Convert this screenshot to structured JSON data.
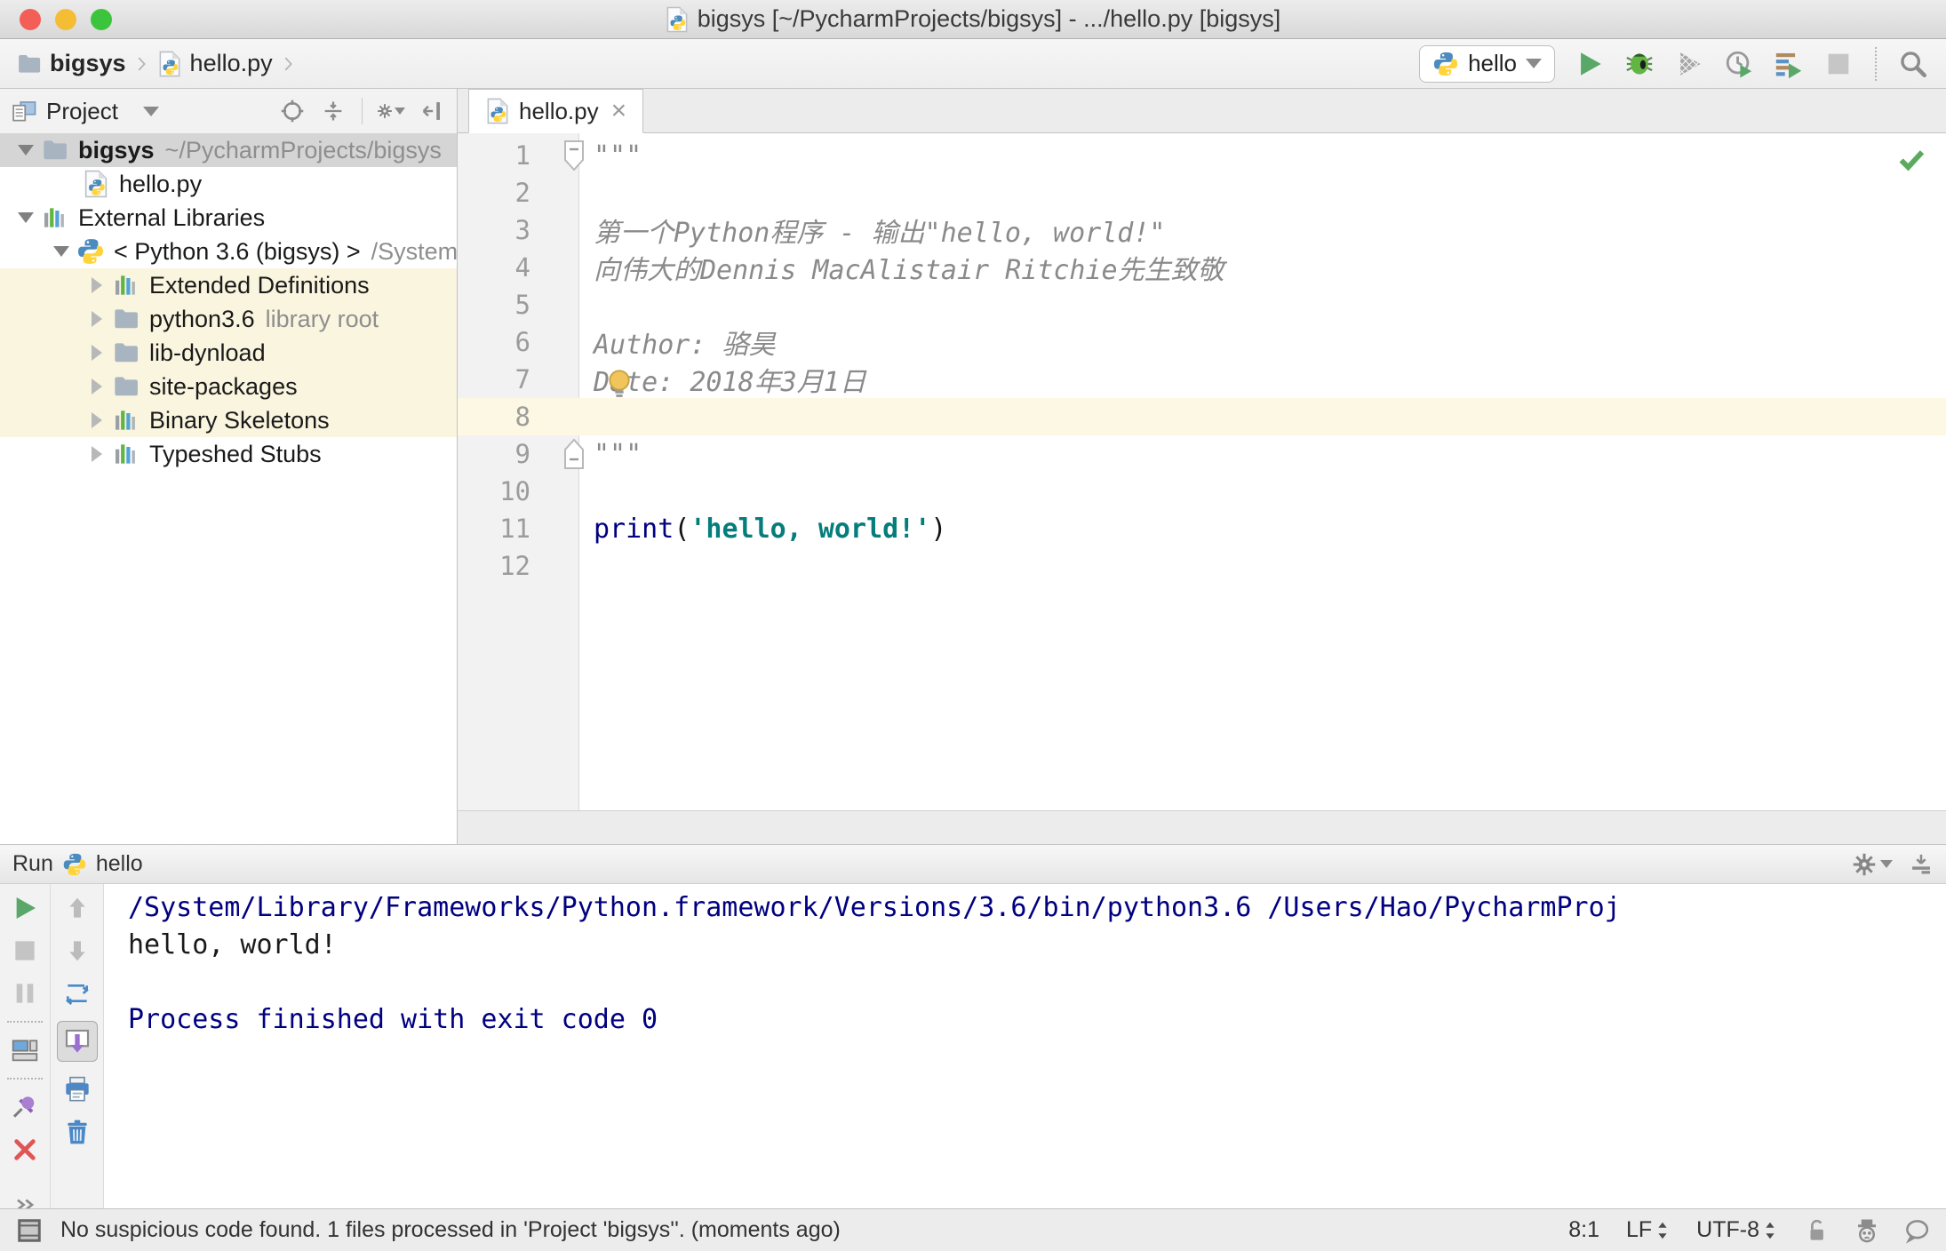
{
  "window": {
    "title": "bigsys [~/PycharmProjects/bigsys] - .../hello.py [bigsys]"
  },
  "navbar": {
    "breadcrumbs": [
      {
        "label": "bigsys",
        "icon": "folder",
        "bold": true
      },
      {
        "label": "hello.py",
        "icon": "pyfile",
        "bold": false
      }
    ],
    "run_config": {
      "label": "hello",
      "icon": "python"
    },
    "actions": [
      {
        "name": "run"
      },
      {
        "name": "debug"
      },
      {
        "name": "run-with-coverage"
      },
      {
        "name": "profiler"
      },
      {
        "name": "concurrency-diagram"
      },
      {
        "name": "stop",
        "disabled": true
      }
    ],
    "search": {
      "name": "search"
    }
  },
  "project_panel": {
    "title": "Project",
    "header_actions": [
      {
        "name": "locate"
      },
      {
        "name": "collapse-all"
      },
      {
        "name": "separator"
      },
      {
        "name": "settings",
        "caret": true
      },
      {
        "name": "hide-panel"
      }
    ],
    "tree": [
      {
        "label": "bigsys",
        "suffix": "~/PycharmProjects/bigsys",
        "icon": "folder",
        "arrow": "down",
        "indent": 0,
        "selected": true,
        "bold": true
      },
      {
        "label": "hello.py",
        "icon": "pyfile",
        "arrow": "none",
        "indent": 2
      },
      {
        "label": "External Libraries",
        "icon": "lib",
        "arrow": "down",
        "indent": 0
      },
      {
        "label": "< Python 3.6 (bigsys) >",
        "suffix": "/System",
        "icon": "python",
        "arrow": "down",
        "indent": 1
      },
      {
        "label": "Extended Definitions",
        "icon": "lib",
        "arrow": "right",
        "indent": 2,
        "highlight": true
      },
      {
        "label": "python3.6",
        "suffix": "library root",
        "icon": "folder",
        "arrow": "right",
        "indent": 2,
        "highlight": true
      },
      {
        "label": "lib-dynload",
        "icon": "folder",
        "arrow": "right",
        "indent": 2,
        "highlight": true
      },
      {
        "label": "site-packages",
        "icon": "folder",
        "arrow": "right",
        "indent": 2,
        "highlight": true
      },
      {
        "label": "Binary Skeletons",
        "icon": "lib",
        "arrow": "right",
        "indent": 2,
        "highlight": true
      },
      {
        "label": "Typeshed Stubs",
        "icon": "lib",
        "arrow": "right",
        "indent": 2
      }
    ]
  },
  "editor": {
    "tab": {
      "label": "hello.py",
      "icon": "pyfile"
    },
    "inspection_status": "ok",
    "lines": [
      {
        "n": 1,
        "tokens": [
          {
            "t": "\"\"\"",
            "c": "comment"
          }
        ],
        "fold": "start"
      },
      {
        "n": 2,
        "tokens": []
      },
      {
        "n": 3,
        "tokens": [
          {
            "t": "第一个Python程序 - 输出\"hello, world!\"",
            "c": "comment"
          }
        ]
      },
      {
        "n": 4,
        "tokens": [
          {
            "t": "向伟大的Dennis MacAlistair Ritchie先生致敬",
            "c": "comment"
          }
        ]
      },
      {
        "n": 5,
        "tokens": []
      },
      {
        "n": 6,
        "tokens": [
          {
            "t": "Author: 骆昊",
            "c": "comment"
          }
        ]
      },
      {
        "n": 7,
        "tokens": [
          {
            "t": "Date: 2018年3月1日",
            "c": "comment"
          }
        ],
        "bulb": true
      },
      {
        "n": 8,
        "tokens": [],
        "current": true
      },
      {
        "n": 9,
        "tokens": [
          {
            "t": "\"\"\"",
            "c": "comment"
          }
        ],
        "fold": "end"
      },
      {
        "n": 10,
        "tokens": []
      },
      {
        "n": 11,
        "tokens": [
          {
            "t": "print",
            "c": "keyword"
          },
          {
            "t": "(",
            "c": "plain"
          },
          {
            "t": "'hello, world!'",
            "c": "string"
          },
          {
            "t": ")",
            "c": "plain"
          }
        ]
      },
      {
        "n": 12,
        "tokens": []
      }
    ]
  },
  "run_panel": {
    "title": "Run",
    "config_label": "hello",
    "config_icon": "python",
    "header_actions": [
      {
        "name": "settings",
        "caret": true
      },
      {
        "name": "dock"
      }
    ],
    "toolbar_left": [
      {
        "name": "rerun"
      },
      {
        "name": "stop",
        "disabled": true
      },
      {
        "name": "pause",
        "disabled": true
      },
      {
        "name": "separator"
      },
      {
        "name": "restore-layout"
      },
      {
        "name": "separator"
      },
      {
        "name": "pin"
      },
      {
        "name": "close"
      },
      {
        "name": "spacer"
      },
      {
        "name": "more"
      }
    ],
    "toolbar_right": [
      {
        "name": "up"
      },
      {
        "name": "down"
      },
      {
        "name": "soft-wrap"
      },
      {
        "name": "scroll-to-end",
        "selected": true
      },
      {
        "name": "print"
      },
      {
        "name": "clear"
      }
    ],
    "console": [
      {
        "text": "/System/Library/Frameworks/Python.framework/Versions/3.6/bin/python3.6 /Users/Hao/PycharmProj",
        "kind": "system"
      },
      {
        "text": "hello, world!",
        "kind": "stdout"
      },
      {
        "text": "",
        "kind": "stdout"
      },
      {
        "text": "Process finished with exit code 0",
        "kind": "system"
      }
    ]
  },
  "statusbar": {
    "message": "No suspicious code found. 1 files processed in 'Project 'bigsys''. (moments ago)",
    "caret_position": "8:1",
    "line_separator": "LF",
    "encoding": "UTF-8",
    "icons": [
      {
        "name": "lock"
      },
      {
        "name": "hector"
      },
      {
        "name": "event-bubble"
      }
    ]
  },
  "colors": {
    "accent_green": "#59a869",
    "keyword": "#000080",
    "string": "#067d7d",
    "comment": "#8a8a8a",
    "console_system": "#000080",
    "selection_gray": "#d5d5d5",
    "library_highlight": "#faf5df",
    "caret_line": "#fcf8e3"
  }
}
